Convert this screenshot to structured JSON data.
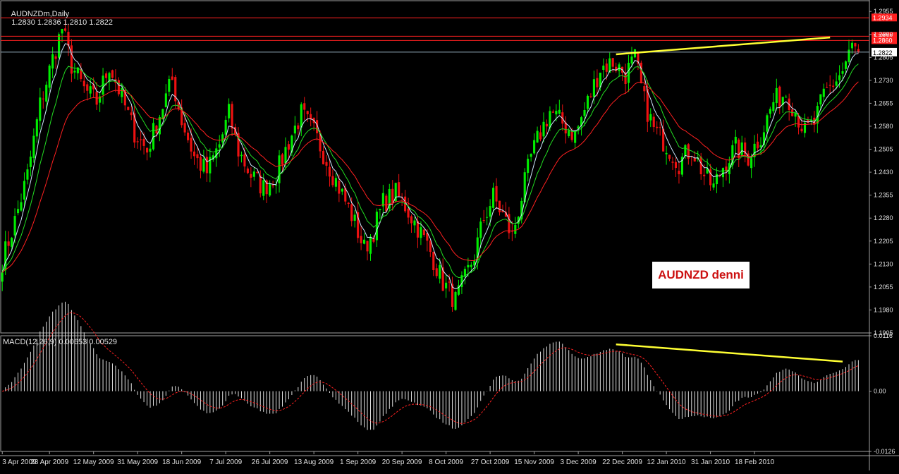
{
  "chart_data": [
    {
      "type": "candlestick",
      "header": {
        "symbol": "AUDNZDm,Daily",
        "ohlc": "1.2830 1.2836 1.2810 1.2822"
      },
      "ylim": [
        1.1905,
        1.299
      ],
      "y_ticks": [
        "1.2955",
        "1.2880",
        "1.2805",
        "1.2730",
        "1.2655",
        "1.2580",
        "1.2505",
        "1.2430",
        "1.2355",
        "1.2280",
        "1.2205",
        "1.2130",
        "1.2055",
        "1.1980",
        "1.1905"
      ],
      "y_tick_values": [
        1.2955,
        1.288,
        1.2805,
        1.273,
        1.2655,
        1.258,
        1.2505,
        1.243,
        1.2355,
        1.228,
        1.2205,
        1.213,
        1.2055,
        1.198,
        1.1905
      ],
      "current_price_label": "1.2822",
      "current_price": 1.2822,
      "hlines": [
        {
          "value": 1.2934,
          "label": "1.2934",
          "color": "#ff2020"
        },
        {
          "value": 1.2874,
          "label": "1.2874",
          "color": "#ff2020"
        },
        {
          "value": 1.286,
          "label": "1.2860",
          "color": "#ff2020"
        }
      ],
      "trendline": {
        "from_x": 195,
        "from_y": 1.2815,
        "to_x": 263,
        "to_y": 1.287,
        "color": "#ffff33"
      },
      "x_labels": [
        "3 Apr 2009",
        "23 Apr 2009",
        "12 May 2009",
        "31 May 2009",
        "18 Jun 2009",
        "7 Jul 2009",
        "26 Jul 2009",
        "13 Aug 2009",
        "1 Sep 2009",
        "20 Sep 2009",
        "8 Oct 2009",
        "27 Oct 2009",
        "15 Nov 2009",
        "3 Dec 2009",
        "22 Dec 2009",
        "12 Jan 2010",
        "31 Jan 2010",
        "18 Feb 2010"
      ],
      "x_label_index": [
        0,
        15,
        29,
        43,
        57,
        71,
        85,
        99,
        113,
        127,
        141,
        155,
        169,
        183,
        197,
        211,
        225,
        239
      ],
      "bar_count": 265,
      "close_anchors": [
        [
          0,
          1.214
        ],
        [
          4,
          1.227
        ],
        [
          8,
          1.242
        ],
        [
          12,
          1.265
        ],
        [
          16,
          1.28
        ],
        [
          19,
          1.29
        ],
        [
          22,
          1.278
        ],
        [
          26,
          1.27
        ],
        [
          30,
          1.266
        ],
        [
          34,
          1.278
        ],
        [
          37,
          1.27
        ],
        [
          42,
          1.256
        ],
        [
          46,
          1.25
        ],
        [
          50,
          1.262
        ],
        [
          54,
          1.273
        ],
        [
          57,
          1.26
        ],
        [
          61,
          1.248
        ],
        [
          65,
          1.243
        ],
        [
          69,
          1.252
        ],
        [
          72,
          1.262
        ],
        [
          75,
          1.25
        ],
        [
          79,
          1.242
        ],
        [
          83,
          1.238
        ],
        [
          87,
          1.242
        ],
        [
          91,
          1.253
        ],
        [
          95,
          1.262
        ],
        [
          99,
          1.256
        ],
        [
          103,
          1.247
        ],
        [
          107,
          1.238
        ],
        [
          111,
          1.229
        ],
        [
          115,
          1.218
        ],
        [
          118,
          1.224
        ],
        [
          121,
          1.233
        ],
        [
          125,
          1.236
        ],
        [
          128,
          1.232
        ],
        [
          132,
          1.225
        ],
        [
          136,
          1.217
        ],
        [
          140,
          1.207
        ],
        [
          144,
          1.201
        ],
        [
          147,
          1.208
        ],
        [
          150,
          1.216
        ],
        [
          153,
          1.228
        ],
        [
          156,
          1.235
        ],
        [
          159,
          1.229
        ],
        [
          162,
          1.222
        ],
        [
          165,
          1.235
        ],
        [
          168,
          1.248
        ],
        [
          171,
          1.256
        ],
        [
          174,
          1.263
        ],
        [
          178,
          1.259
        ],
        [
          182,
          1.255
        ],
        [
          186,
          1.266
        ],
        [
          190,
          1.277
        ],
        [
          194,
          1.279
        ],
        [
          198,
          1.275
        ],
        [
          201,
          1.28
        ],
        [
          204,
          1.266
        ],
        [
          207,
          1.257
        ],
        [
          211,
          1.252
        ],
        [
          215,
          1.246
        ],
        [
          219,
          1.251
        ],
        [
          223,
          1.242
        ],
        [
          226,
          1.238
        ],
        [
          229,
          1.245
        ],
        [
          233,
          1.251
        ],
        [
          237,
          1.248
        ],
        [
          241,
          1.255
        ],
        [
          245,
          1.266
        ],
        [
          249,
          1.269
        ],
        [
          252,
          1.263
        ],
        [
          255,
          1.256
        ],
        [
          258,
          1.259
        ],
        [
          261,
          1.268
        ],
        [
          264,
          1.272
        ],
        [
          267,
          1.276
        ],
        [
          270,
          1.284
        ],
        [
          272,
          1.2822
        ]
      ],
      "overlay_label": "AUDNZD denni"
    },
    {
      "type": "bar",
      "header": "MACD(12,26,9) 0.00653 0.00529",
      "ylim": [
        -0.0126,
        0.0116
      ],
      "y_ticks": [
        "0.0116",
        "0.00",
        "-0.0126"
      ],
      "y_tick_values": [
        0.0116,
        0.0,
        -0.0126
      ],
      "trendline": {
        "from_x": 195,
        "from_y": 0.0098,
        "to_x": 267,
        "to_y": 0.0062,
        "color": "#ffff33"
      }
    }
  ],
  "colors": {
    "background": "#000000",
    "up_candle": "#00ee00",
    "down_candle": "#ee1111",
    "ma_fast": "#cfe8ff",
    "ma_mid": "#22dd22",
    "ma_slow": "#ff2020",
    "grid_border": "#a0a0a0",
    "macd_hist": "#e0e0e0",
    "macd_signal": "#ff2020",
    "trend": "#ffff33"
  }
}
